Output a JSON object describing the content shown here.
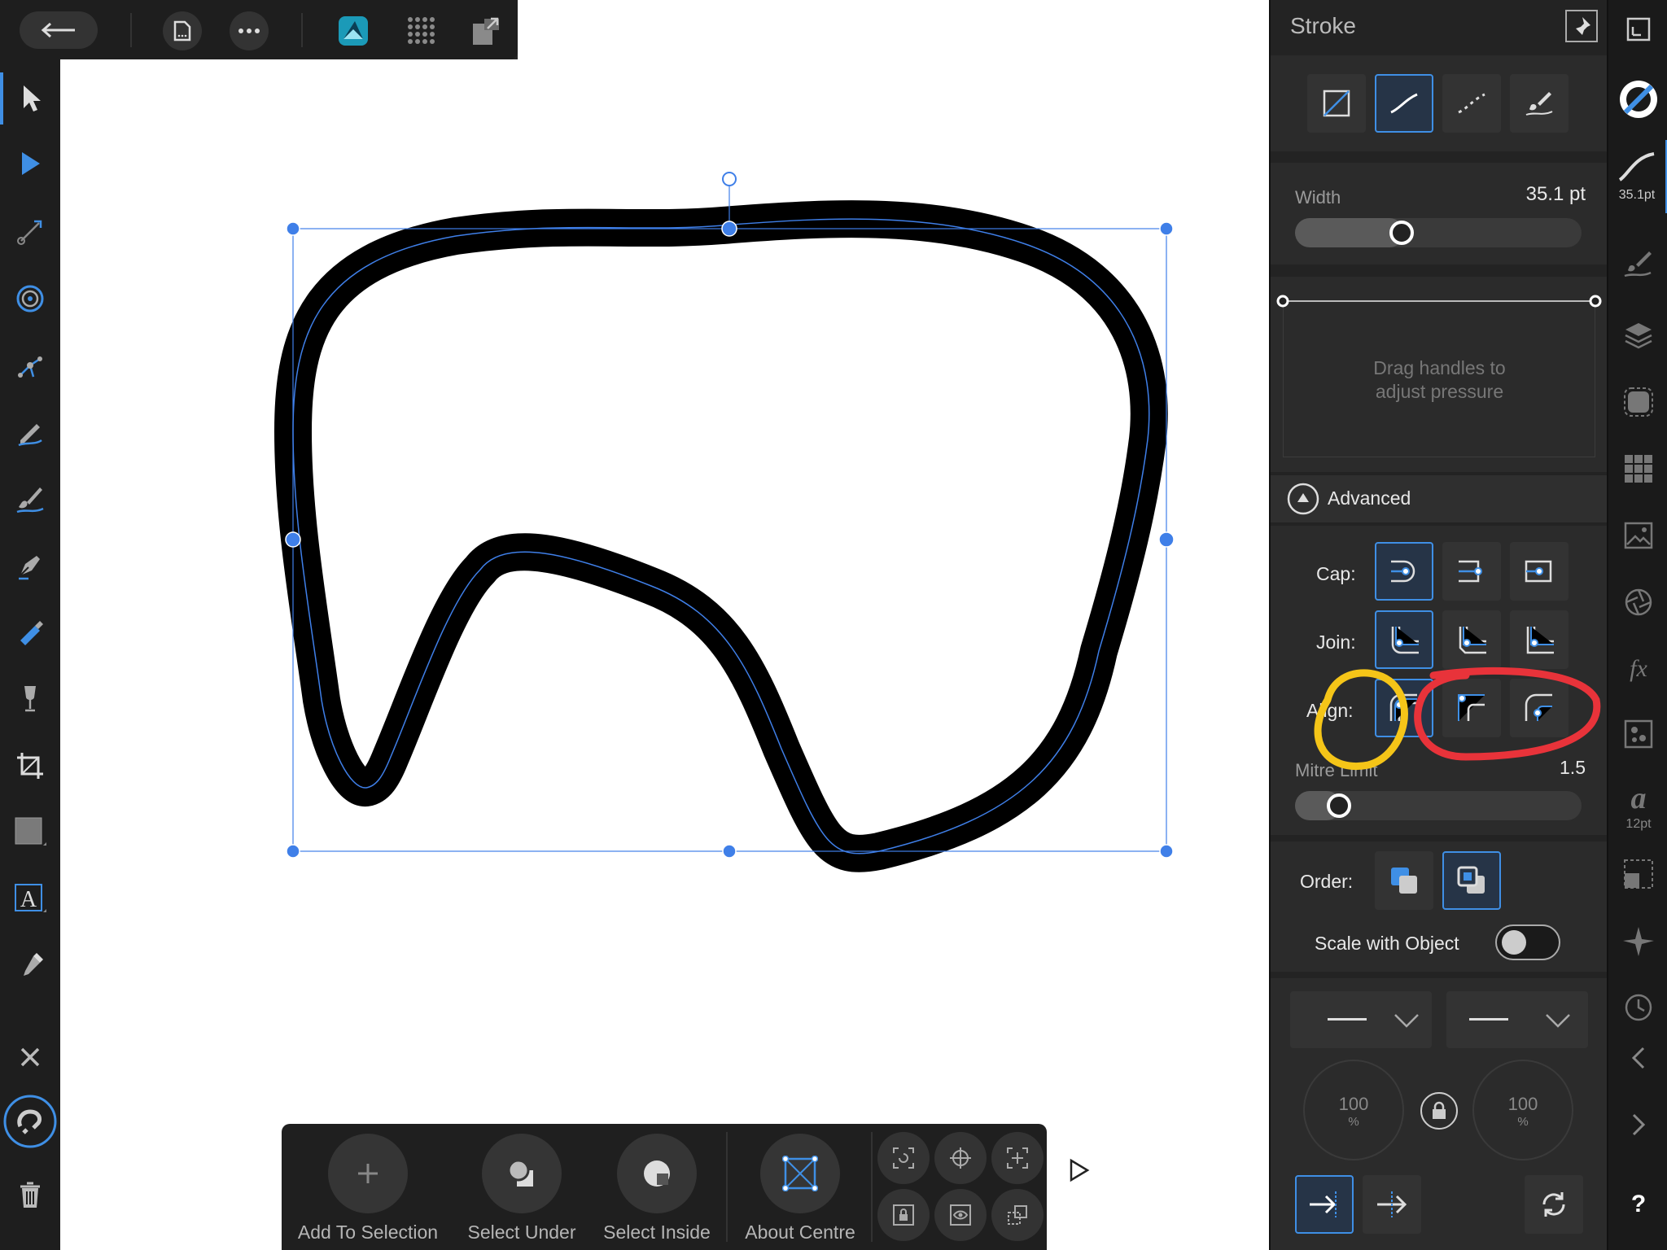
{
  "top_toolbar": {
    "icons": [
      "back-arrow-icon",
      "document-icon",
      "more-icon",
      "affinity-designer-icon",
      "pixel-persona-icon",
      "export-persona-icon"
    ]
  },
  "left_tools": [
    "move-tool",
    "node-tool",
    "corner-tool",
    "point-transform-tool",
    "contour-tool",
    "pencil-tool",
    "vector-brush-tool",
    "pen-tool",
    "fill-tool",
    "transparency-tool",
    "crop-tool",
    "shape-tool",
    "text-tool",
    "color-picker-tool"
  ],
  "stroke_panel": {
    "title": "Stroke",
    "width_label": "Width",
    "width_value": "35.1 pt",
    "width_fraction": 0.36,
    "pressure_hint_line1": "Drag handles to",
    "pressure_hint_line2": "adjust pressure",
    "advanced_label": "Advanced",
    "cap_label": "Cap:",
    "join_label": "Join:",
    "align_label": "Align:",
    "mitre_label": "Mitre Limit",
    "mitre_value": "1.5",
    "mitre_fraction": 0.12,
    "order_label": "Order:",
    "scale_label": "Scale with Object",
    "arrow_left_scale": "100",
    "arrow_right_scale": "100",
    "percent": "%"
  },
  "right_rail": {
    "stroke_width_label": "35.1pt",
    "text_size_label": "12pt"
  },
  "context_bar": {
    "add_label": "Add To Selection",
    "under_label": "Select Under",
    "inside_label": "Select Inside",
    "centre_label": "About Centre"
  },
  "colors": {
    "accent": "#3f8fe5",
    "highlight_yellow": "#f5c518",
    "highlight_red": "#e8333a"
  }
}
